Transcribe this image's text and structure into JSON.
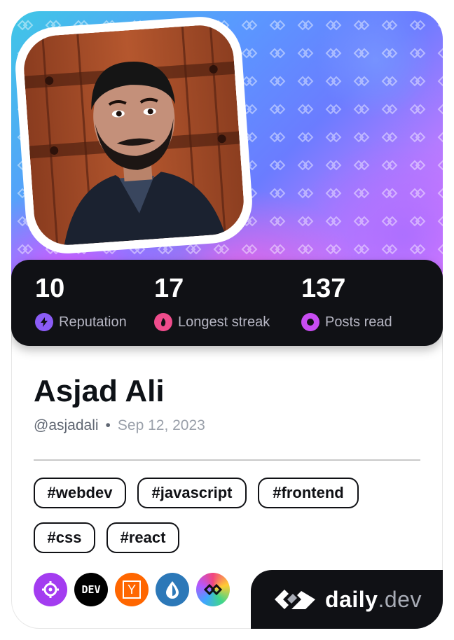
{
  "profile": {
    "name": "Asjad Ali",
    "username": "@asjadali",
    "separator": "•",
    "joined": "Sep 12, 2023"
  },
  "stats": [
    {
      "value": "10",
      "label": "Reputation",
      "icon": "lightning-icon",
      "color": "#8b5cf6"
    },
    {
      "value": "17",
      "label": "Longest streak",
      "icon": "flame-icon",
      "color": "#ef4c8c"
    },
    {
      "value": "137",
      "label": "Posts read",
      "icon": "eye-ring-icon",
      "color": "#c84cf2"
    }
  ],
  "tags": [
    "#webdev",
    "#javascript",
    "#frontend",
    "#css",
    "#react"
  ],
  "sources": [
    {
      "icon": "crosshair-icon",
      "bg": "#a33cf0"
    },
    {
      "icon": "dev-icon",
      "text": "DEV",
      "bg": "#000000"
    },
    {
      "icon": "hacker-news-icon",
      "text": "Y",
      "bg": "#ff6600"
    },
    {
      "icon": "droplet-icon",
      "bg": "#2c78b8"
    },
    {
      "icon": "daily-dev-icon",
      "bg": "#f1467f"
    }
  ],
  "brand": {
    "word": "daily",
    "suffix": ".dev"
  },
  "colors": {
    "dark": "#101115",
    "accent_purple": "#a33cf0"
  }
}
